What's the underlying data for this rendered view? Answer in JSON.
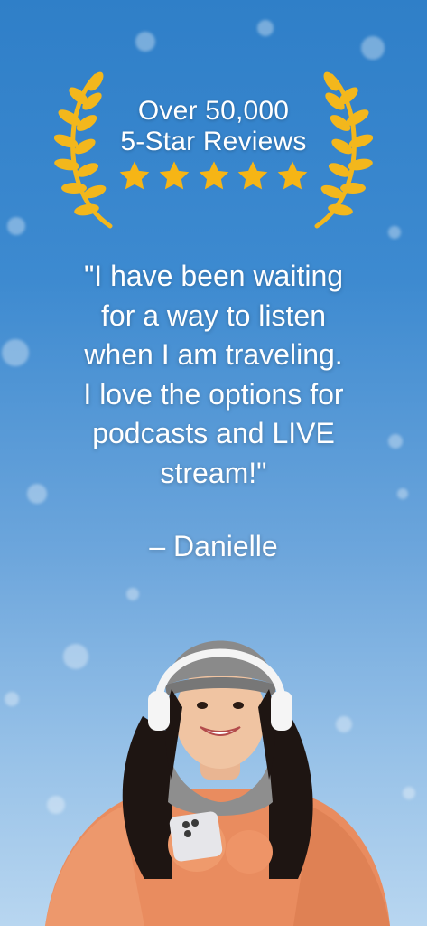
{
  "award": {
    "line1": "Over 50,000",
    "line2": "5-Star Reviews",
    "star_count": 5,
    "star_color": "#f6b515",
    "laurel_color": "#f3b71c"
  },
  "testimonial": {
    "quote_lines": [
      "\"I have been waiting",
      "for a way to listen",
      "when I am traveling.",
      "I love the options for",
      "podcasts and LIVE",
      "stream!\""
    ],
    "author": "– Danielle"
  },
  "photo": {
    "subject": "woman-with-headphones-and-phone"
  },
  "colors": {
    "background_top": "#2f7fc8",
    "background_bottom": "#b8d6f0",
    "text": "#ffffff"
  }
}
